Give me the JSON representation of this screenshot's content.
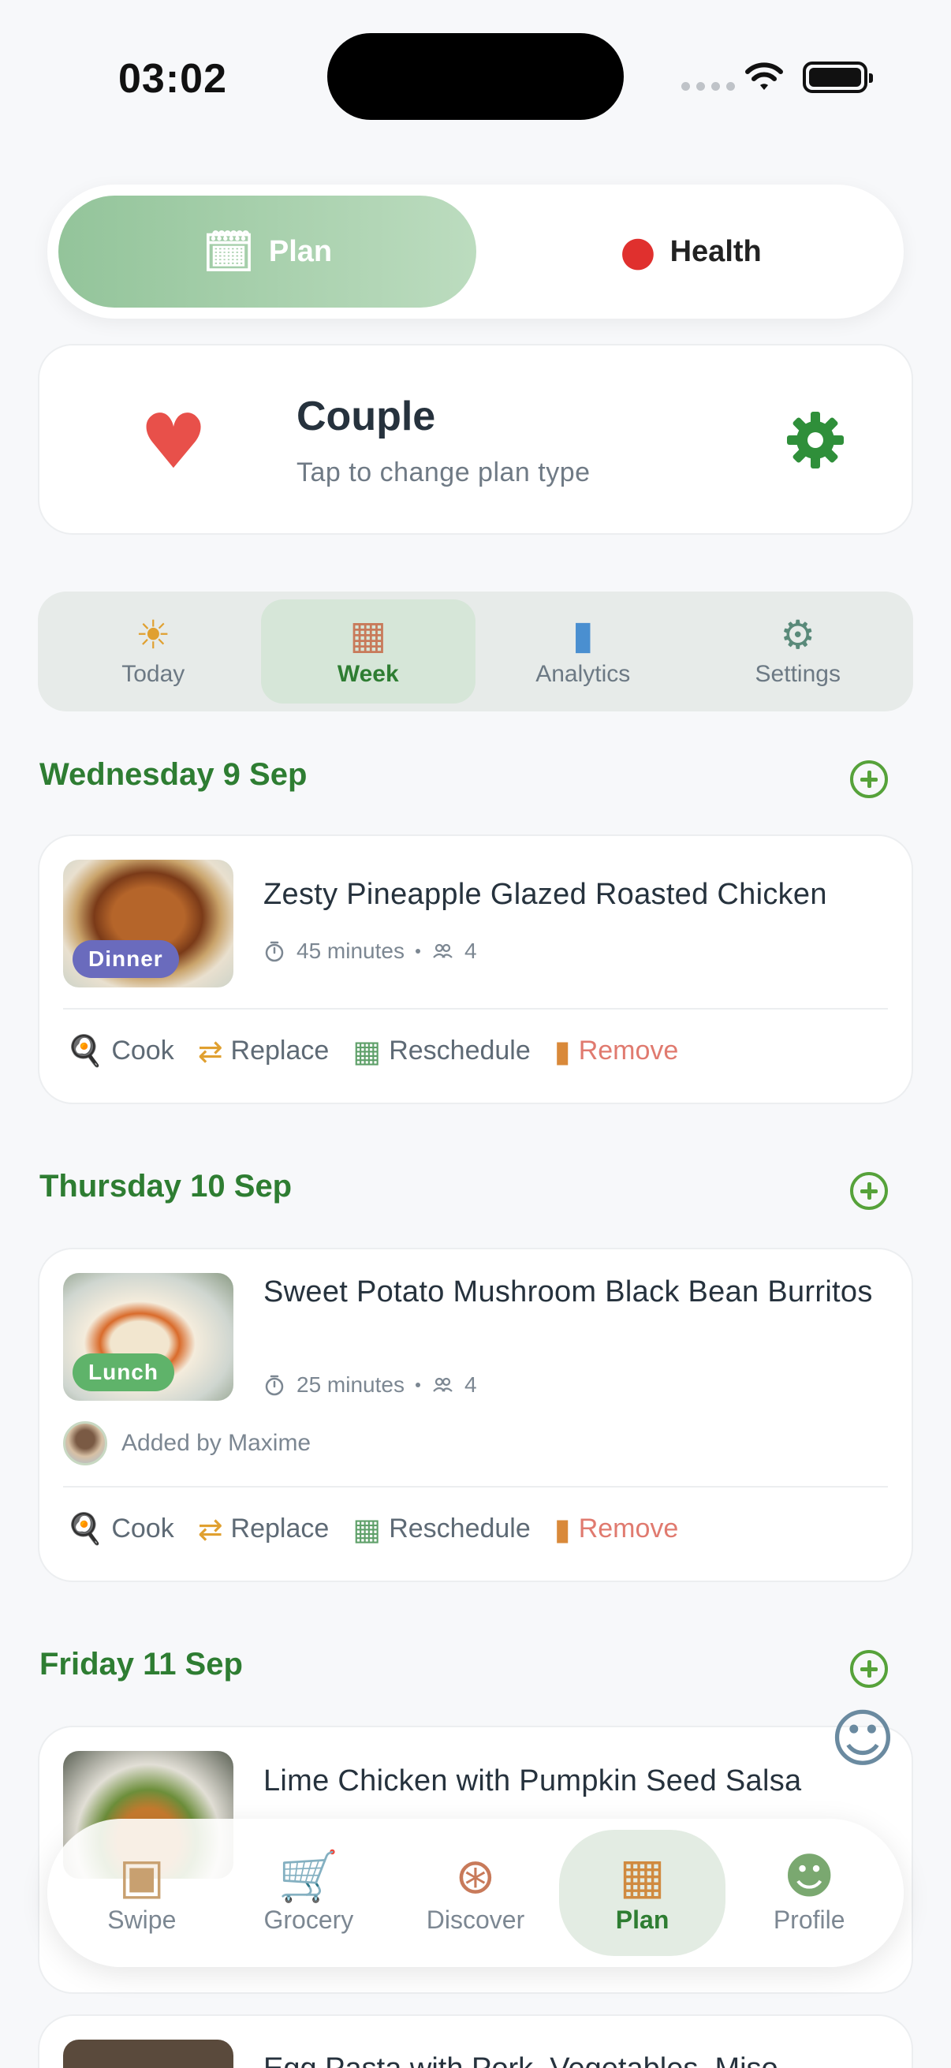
{
  "status_bar": {
    "time": "03:02"
  },
  "mode_toggle": {
    "plan": {
      "label": "Plan",
      "icon": "calendar-food-icon"
    },
    "health": {
      "label": "Health",
      "icon": "apple-icon"
    }
  },
  "plan_type": {
    "title": "Couple",
    "subtitle": "Tap to change plan type",
    "icon": "couple-food-icon"
  },
  "tabs": [
    {
      "label": "Today",
      "icon": "today-icon"
    },
    {
      "label": "Week",
      "icon": "week-calendar-icon",
      "active": true
    },
    {
      "label": "Analytics",
      "icon": "chart-icon"
    },
    {
      "label": "Settings",
      "icon": "gear-icon"
    }
  ],
  "days": [
    {
      "date": "Wednesday 9 Sep",
      "meal": {
        "title": "Zesty Pineapple Glazed Roasted Chicken",
        "badge": "Dinner",
        "duration": "45 minutes",
        "servings": "4"
      }
    },
    {
      "date": "Thursday 10 Sep",
      "meal": {
        "title": "Sweet Potato Mushroom Black Bean Burritos",
        "badge": "Lunch",
        "duration": "25 minutes",
        "servings": "4",
        "added_by": "Added by Maxime"
      }
    },
    {
      "date": "Friday 11 Sep",
      "meal": {
        "title": "Lime Chicken with Pumpkin Seed Salsa"
      }
    }
  ],
  "actions": {
    "cook": "Cook",
    "replace": "Replace",
    "reschedule": "Reschedule",
    "remove": "Remove"
  },
  "next_meal_title": "Egg Pasta with Pork, Vegetables, Miso",
  "bottom_nav": [
    {
      "label": "Swipe",
      "icon": "swipe-icon"
    },
    {
      "label": "Grocery",
      "icon": "grocery-cart-icon"
    },
    {
      "label": "Discover",
      "icon": "compass-icon"
    },
    {
      "label": "Plan",
      "icon": "plan-calendar-icon",
      "active": true
    },
    {
      "label": "Profile",
      "icon": "profile-icon"
    }
  ],
  "colors": {
    "accent_green": "#2e7d32",
    "dinner_badge": "#6a6bbd",
    "lunch_badge": "#5fb36a",
    "remove_red": "#e07a6f"
  }
}
